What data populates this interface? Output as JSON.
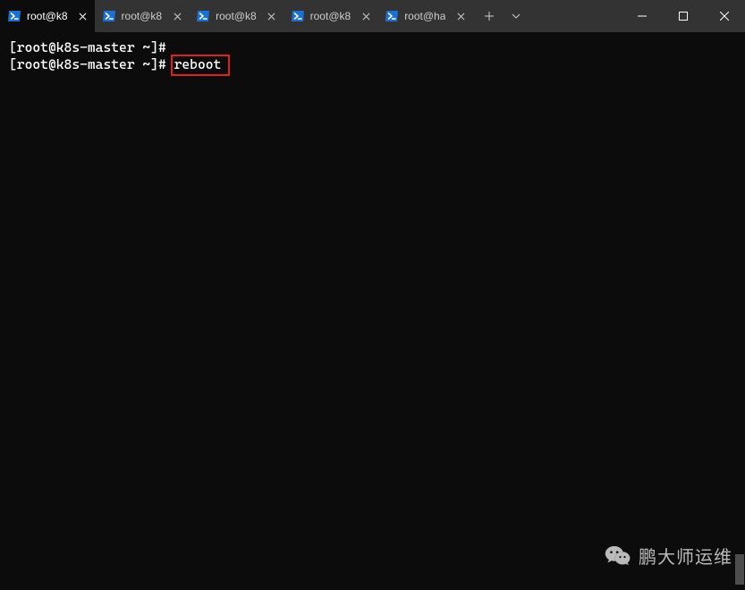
{
  "titlebar": {
    "tabs": [
      {
        "label": "root@k8",
        "active": true
      },
      {
        "label": "root@k8",
        "active": false
      },
      {
        "label": "root@k8",
        "active": false
      },
      {
        "label": "root@k8",
        "active": false
      },
      {
        "label": "root@ha",
        "active": false
      }
    ],
    "new_tab_glyph": "+",
    "dropdown_glyph": "⌄"
  },
  "terminal": {
    "lines": [
      {
        "prompt": "[root@k8s-master ~]#",
        "command": ""
      },
      {
        "prompt": "[root@k8s-master ~]#",
        "command": "reboot",
        "highlight": true
      }
    ]
  },
  "watermark": {
    "text": "鹏大师运维"
  },
  "icons": {
    "powershell": "powershell-icon",
    "close_x": "close-icon",
    "minimize": "minimize-icon",
    "maximize": "maximize-icon"
  }
}
